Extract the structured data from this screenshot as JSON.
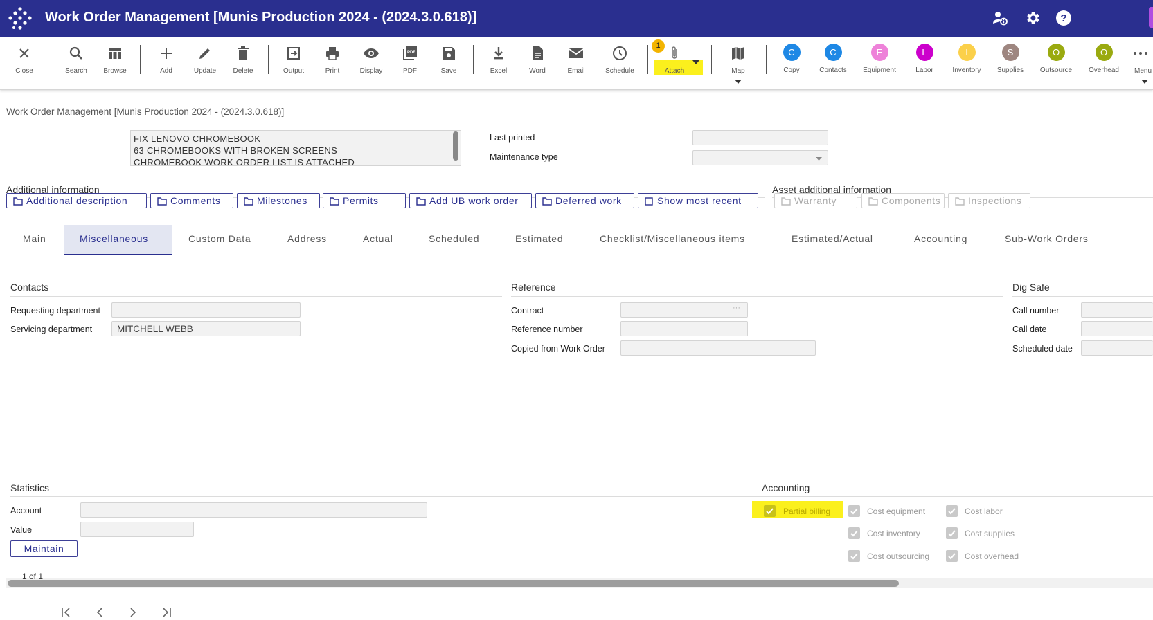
{
  "app": {
    "title": "Work Order Management [Munis Production 2024 - (2024.3.0.618)]"
  },
  "toolbar": {
    "close": "Close",
    "search": "Search",
    "browse": "Browse",
    "add": "Add",
    "update": "Update",
    "delete": "Delete",
    "output": "Output",
    "print": "Print",
    "display": "Display",
    "pdf": "PDF",
    "save": "Save",
    "excel": "Excel",
    "word": "Word",
    "email": "Email",
    "schedule": "Schedule",
    "attach": "Attach",
    "attach_badge": "1",
    "map": "Map",
    "copy": "Copy",
    "contacts": "Contacts",
    "equipment": "Equipment",
    "labor": "Labor",
    "inventory": "Inventory",
    "supplies": "Supplies",
    "outsource": "Outsource",
    "overhead": "Overhead",
    "menu": "Menu",
    "copy_letter": "C",
    "contacts_letter": "C",
    "equipment_letter": "E",
    "labor_letter": "L",
    "inventory_letter": "I",
    "supplies_letter": "S",
    "outsource_letter": "O",
    "overhead_letter": "O",
    "colors": {
      "copy": "#1e88e5",
      "contacts": "#1e88e5",
      "equipment": "#ee82d9",
      "labor": "#cc00cc",
      "inventory": "#fbd04a",
      "supplies": "#9e8680",
      "outsource": "#9aaa10",
      "overhead": "#9aaa10",
      "highlight": "#fbf01d",
      "brand": "#2a2f8f"
    }
  },
  "breadcrumb": "Work Order Management [Munis Production 2024 - (2024.3.0.618)]",
  "description": {
    "line1": "FIX LENOVO CHROMEBOOK",
    "line2": "63 CHROMEBOOKS WITH BROKEN SCREENS",
    "line3": "CHROMEBOOK WORK ORDER LIST IS ATTACHED"
  },
  "last_printed": {
    "label": "Last printed",
    "value": ""
  },
  "maintenance_type": {
    "label": "Maintenance type",
    "value": ""
  },
  "additional_info": {
    "title": "Additional information",
    "buttons": [
      "Additional description",
      "Comments",
      "Milestones",
      "Permits",
      "Add UB work order",
      "Deferred work",
      "Show most recent"
    ]
  },
  "asset_info": {
    "title": "Asset additional information",
    "buttons": [
      "Warranty",
      "Components",
      "Inspections"
    ]
  },
  "tabs": [
    "Main",
    "Miscellaneous",
    "Custom Data",
    "Address",
    "Actual",
    "Scheduled",
    "Estimated",
    "Checklist/Miscellaneous items",
    "Estimated/Actual",
    "Accounting",
    "Sub-Work Orders"
  ],
  "contacts": {
    "title": "Contacts",
    "requesting_label": "Requesting department",
    "requesting_value": "",
    "servicing_label": "Servicing department",
    "servicing_value": "MITCHELL WEBB"
  },
  "reference": {
    "title": "Reference",
    "contract_label": "Contract",
    "contract_value": "",
    "refnum_label": "Reference number",
    "refnum_value": "",
    "copied_label": "Copied from Work Order",
    "copied_value": ""
  },
  "dig_safe": {
    "title": "Dig Safe",
    "call_number_label": "Call number",
    "call_date_label": "Call date",
    "scheduled_date_label": "Scheduled date"
  },
  "statistics": {
    "title": "Statistics",
    "account_label": "Account",
    "account_value": "",
    "value_label": "Value",
    "value_value": "",
    "maintain_button": "Maintain"
  },
  "accounting": {
    "title": "Accounting",
    "partial_billing": "Partial billing",
    "cost_equipment": "Cost equipment",
    "cost_labor": "Cost labor",
    "cost_inventory": "Cost inventory",
    "cost_supplies": "Cost supplies",
    "cost_outsourcing": "Cost outsourcing",
    "cost_overhead": "Cost overhead"
  },
  "pager": {
    "text": "1 of 1"
  }
}
